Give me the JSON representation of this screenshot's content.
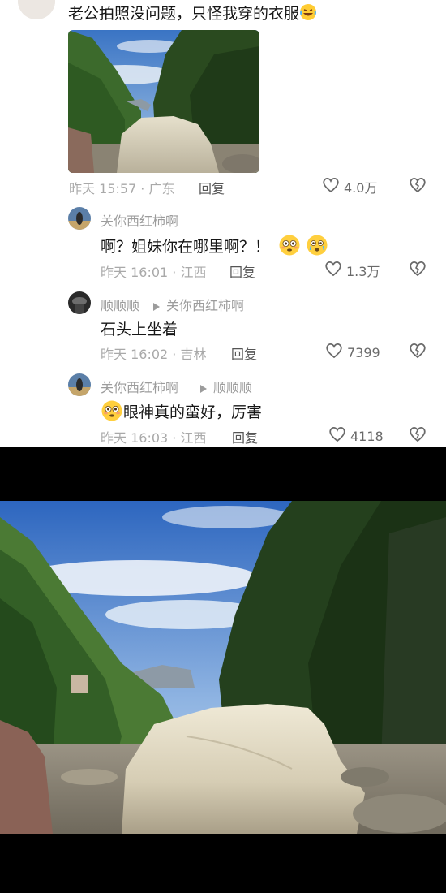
{
  "post": {
    "text": "老公拍照没问题，只怪我穿的衣服",
    "emoji": "rofl-face",
    "time_location": "昨天 15:57 · 广东",
    "reply_label": "回复",
    "likes": "4.0万"
  },
  "replies": [
    {
      "user": "关你西红柿啊",
      "reply_to": "",
      "text": "啊？姐妹你在哪里啊？！",
      "trailing_emojis": [
        "flushed-face",
        "crying-wow-face"
      ],
      "time_location": "昨天 16:01 · 江西",
      "reply_label": "回复",
      "likes": "1.3万"
    },
    {
      "user": "顺顺顺",
      "reply_to": "关你西红柿啊",
      "text": "石头上坐着",
      "time_location": "昨天 16:02 · 吉林",
      "reply_label": "回复",
      "likes": "7399"
    },
    {
      "user": "关你西红柿啊",
      "reply_to": "顺顺顺",
      "leading_emoji": "flushed-face",
      "text": "眼神真的蛮好，厉害",
      "time_location": "昨天 16:03 · 江西",
      "reply_label": "回复",
      "likes": "4118"
    }
  ],
  "colors": {
    "background_top": "#ffffff",
    "background_bottom": "#000000",
    "secondary_text": "#a9a9a9",
    "primary_text": "#161616"
  }
}
